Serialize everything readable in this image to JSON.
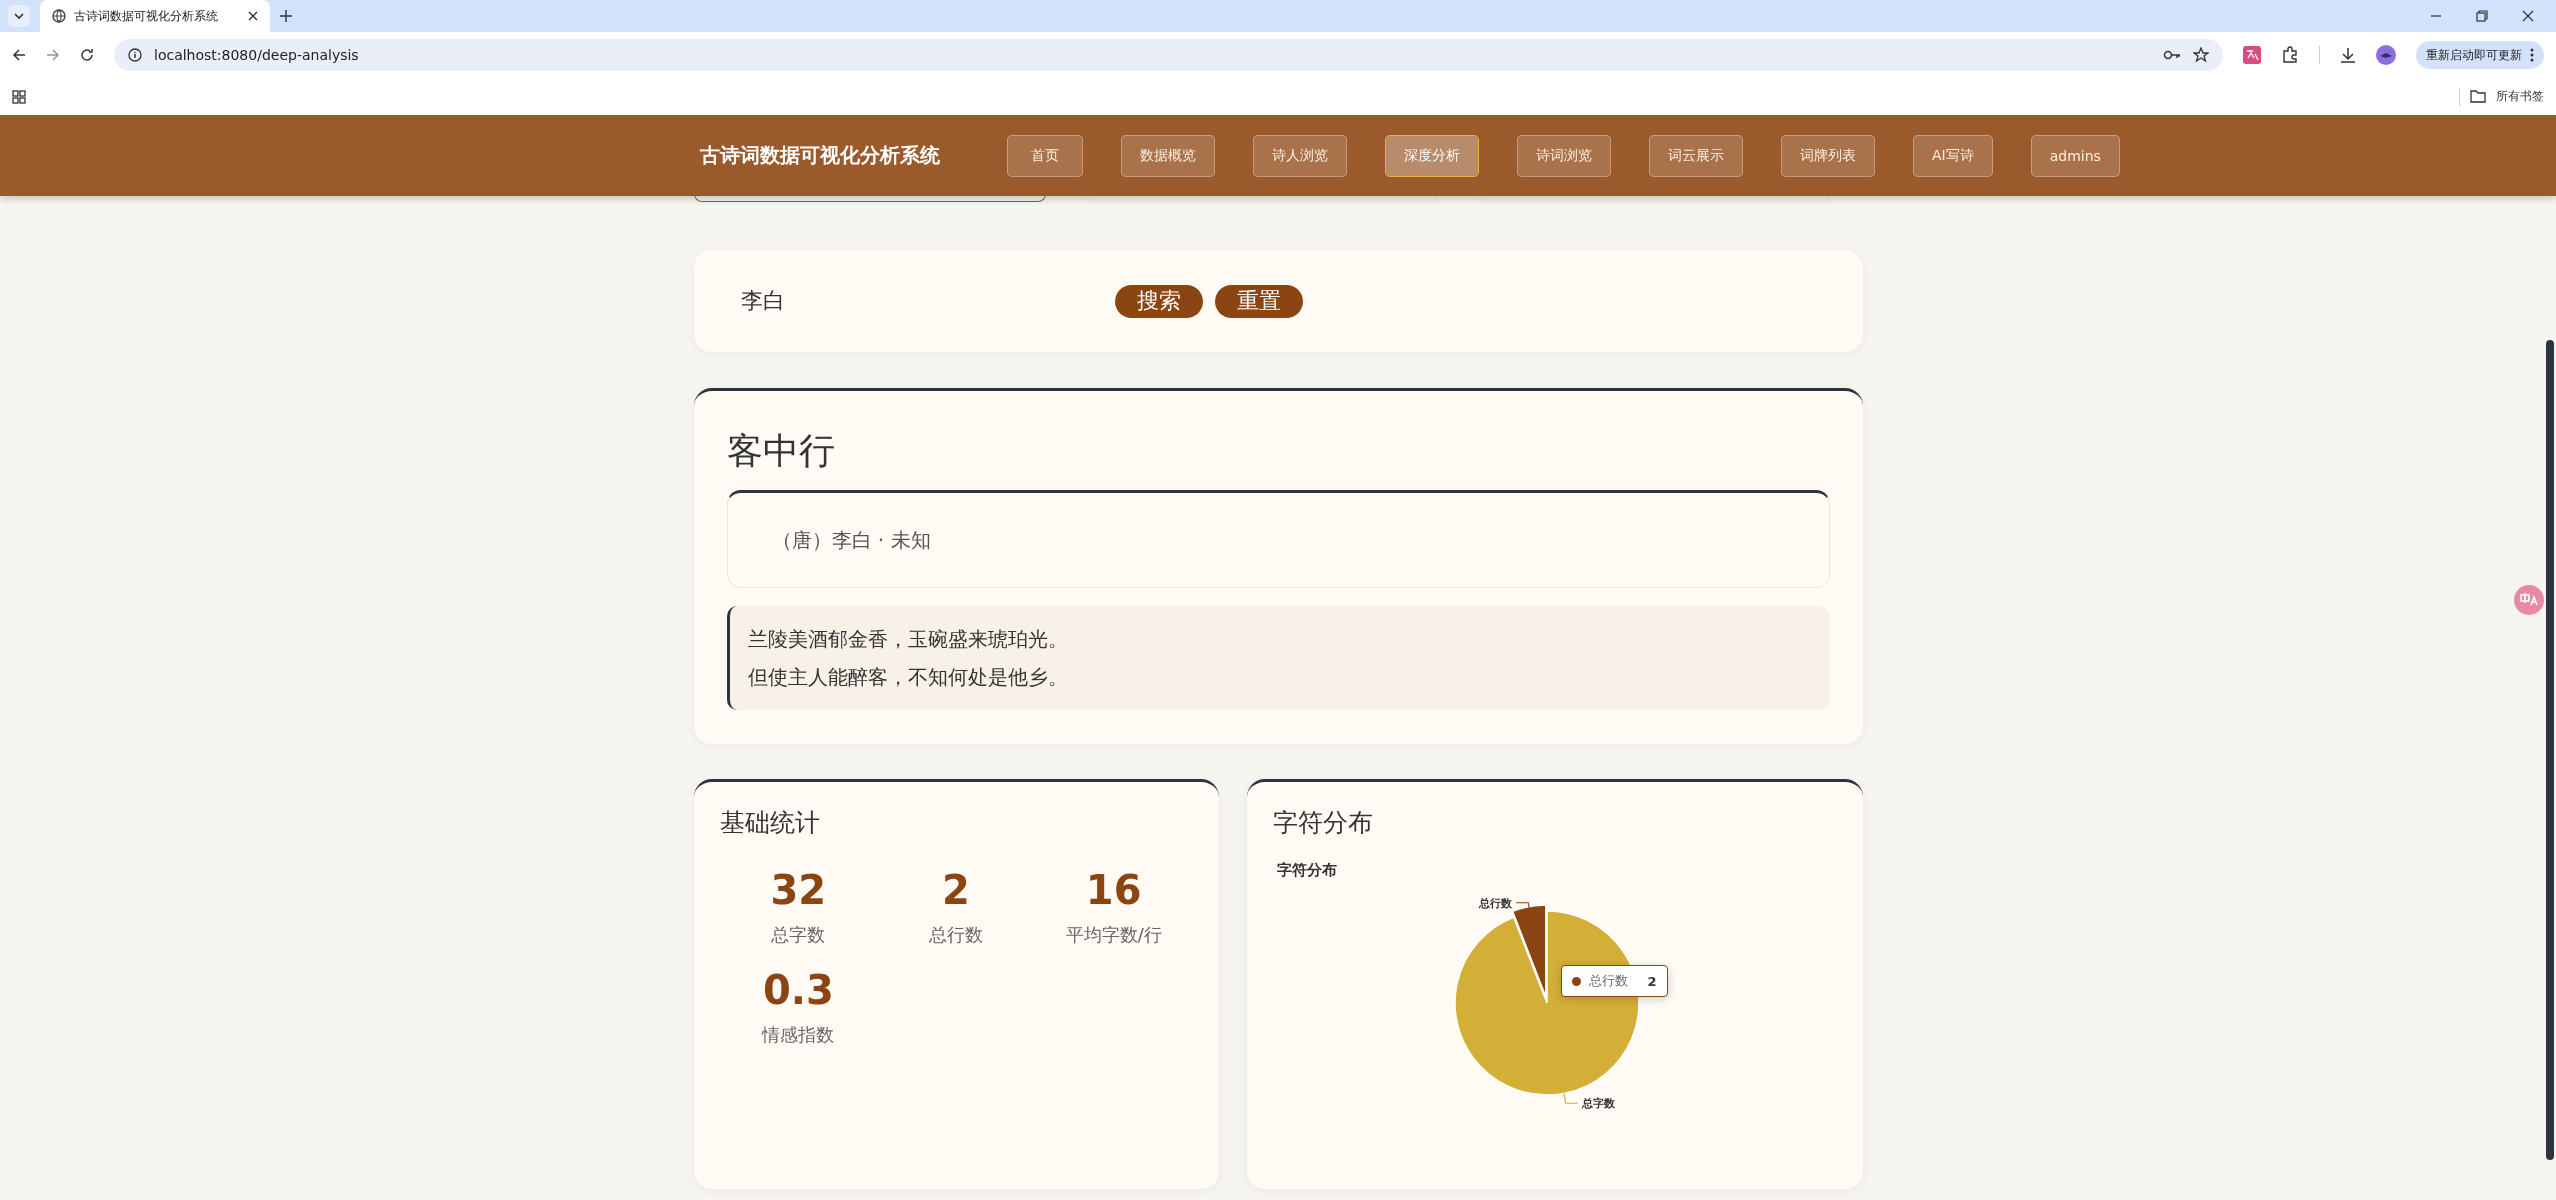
{
  "browser": {
    "tab_title": "古诗词数据可视化分析系统",
    "url": "localhost:8080/deep-analysis",
    "update_button": "重新启动即可更新",
    "bookmarks": "所有书签"
  },
  "nav": {
    "brand": "古诗词数据可视化分析系统",
    "items": [
      {
        "label": "首页",
        "selected": false
      },
      {
        "label": "数据概览",
        "selected": false
      },
      {
        "label": "诗人浏览",
        "selected": false
      },
      {
        "label": "深度分析",
        "selected": true
      },
      {
        "label": "诗词浏览",
        "selected": false
      },
      {
        "label": "词云展示",
        "selected": false
      },
      {
        "label": "词牌列表",
        "selected": false
      },
      {
        "label": "AI写诗",
        "selected": false
      },
      {
        "label": "admins",
        "selected": false
      }
    ]
  },
  "search": {
    "value": "李白",
    "buttons": [
      "搜索",
      "重置"
    ]
  },
  "poem": {
    "title": "客中行",
    "meta": "（唐）李白 · 未知",
    "lines": [
      "兰陵美酒郁金香，玉碗盛来琥珀光。",
      "但使主人能醉客，不知何处是他乡。"
    ]
  },
  "stats": {
    "title": "基础统计",
    "items": [
      {
        "value": "32",
        "label": "总字数"
      },
      {
        "value": "2",
        "label": "总行数"
      },
      {
        "value": "16",
        "label": "平均字数/行"
      },
      {
        "value": "0.3",
        "label": "情感指数"
      }
    ]
  },
  "distribution": {
    "title": "字符分布",
    "chart_data": {
      "type": "pie",
      "title": "字符分布",
      "categories": [
        "总字数",
        "总行数"
      ],
      "series": [
        {
          "values": [
            94.1,
            5.9
          ]
        }
      ],
      "colors": [
        "#d4af37",
        "#8b4513"
      ]
    },
    "tooltip": {
      "label": "总行数",
      "value": "2",
      "color": "#8b4513"
    }
  }
}
